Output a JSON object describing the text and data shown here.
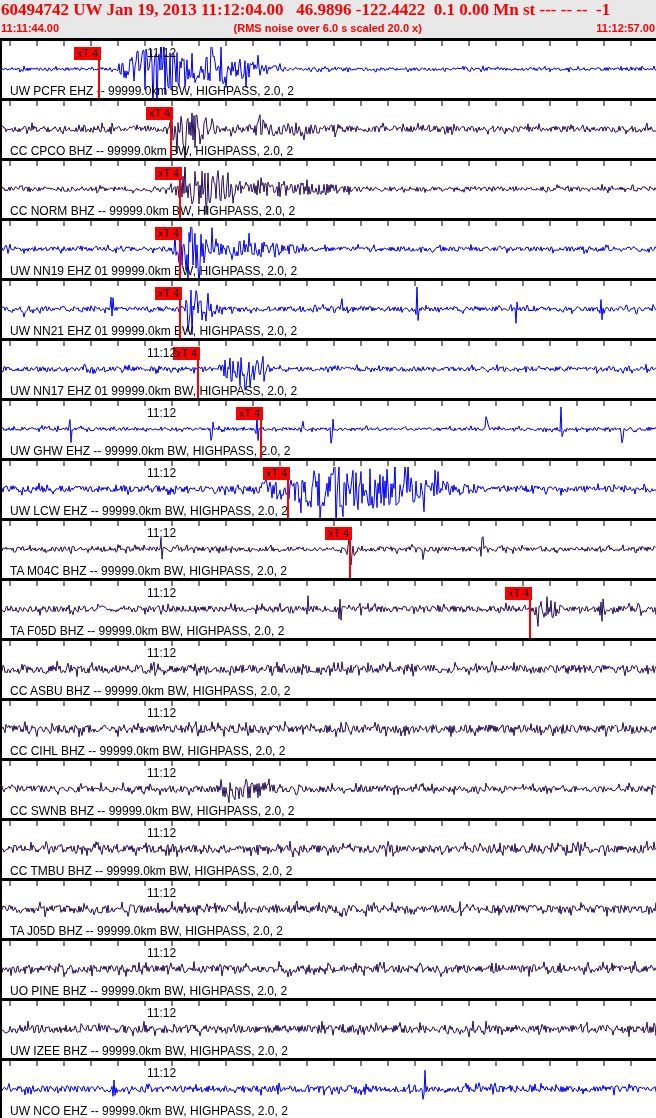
{
  "header": {
    "title": "60494742 UW Jan 19, 2013 11:12:04.00   46.9896 -122.4422  0.1 0.00 Mn st --- -- --  -1",
    "start_time": "11:11:44.00",
    "note": "(RMS noise over 6.0 s scaled 20.0 x)",
    "end_time": "11:12:57.00"
  },
  "traces": [
    {
      "label": "UW PCFR EHZ -- 99999.0km BW, HIGHPASS, 2.0, 2",
      "time_label": "11:12",
      "color": "#0000ff",
      "pick": "xT 4"
    },
    {
      "label": "CC CPCO BHZ -- 99999.0km BW, HIGHPASS, 2.0, 2",
      "color": "#2a0f5e",
      "pick": "xT 4"
    },
    {
      "label": "CC NORM BHZ -- 99999.0km BW, HIGHPASS, 2.0, 2",
      "color": "#2a0f5e",
      "pick": "xT 4"
    },
    {
      "label": "UW NN19 EHZ 01 99999.0km BW, HIGHPASS, 2.0, 2",
      "color": "#0000ff",
      "pick": "xT 4"
    },
    {
      "label": "UW NN21 EHZ 01 99999.0km BW, HIGHPASS, 2.0, 2",
      "color": "#0000ff",
      "pick": "xT 4"
    },
    {
      "label": "UW NN17 EHZ 01 99999.0km BW, HIGHPASS, 2.0, 2",
      "time_label": "11:12",
      "color": "#0000ff",
      "pick": "xT 4"
    },
    {
      "label": "UW GHW EHZ -- 99999.0km BW, HIGHPASS, 2.0, 2",
      "time_label": "11:12",
      "color": "#0000ff",
      "pick": "xT 4"
    },
    {
      "label": "UW LCW EHZ -- 99999.0km BW, HIGHPASS, 2.0, 2",
      "time_label": "11:12",
      "color": "#0000ff",
      "pick": "xT 4"
    },
    {
      "label": "TA M04C BHZ -- 99999.0km BW, HIGHPASS, 2.0, 2",
      "time_label": "11:12",
      "color": "#2a0f5e",
      "pick": "xT 4"
    },
    {
      "label": "TA F05D BHZ -- 99999.0km BW, HIGHPASS, 2.0, 2",
      "time_label": "11:12",
      "color": "#2a0f5e",
      "pick": "xT 4"
    },
    {
      "label": "CC ASBU BHZ -- 99999.0km BW, HIGHPASS, 2.0, 2",
      "time_label": "11:12",
      "color": "#2a0f5e"
    },
    {
      "label": "CC CIHL BHZ -- 99999.0km BW, HIGHPASS, 2.0, 2",
      "time_label": "11:12",
      "color": "#2a0f5e"
    },
    {
      "label": "CC SWNB BHZ -- 99999.0km BW, HIGHPASS, 2.0, 2",
      "time_label": "11:12",
      "color": "#2a0f5e"
    },
    {
      "label": "CC TMBU BHZ -- 99999.0km BW, HIGHPASS, 2.0, 2",
      "time_label": "11:12",
      "color": "#2a0f5e"
    },
    {
      "label": "TA J05D BHZ -- 99999.0km BW, HIGHPASS, 2.0, 2",
      "time_label": "11:12",
      "color": "#2a0f5e"
    },
    {
      "label": "UO PINE BHZ -- 99999.0km BW, HIGHPASS, 2.0, 2",
      "time_label": "11:12",
      "color": "#2a0f5e"
    },
    {
      "label": "UW IZEE BHZ -- 99999.0km BW, HIGHPASS, 2.0, 2",
      "time_label": "11:12",
      "color": "#2a0f5e"
    },
    {
      "label": "UW NCO EHZ -- 99999.0km BW, HIGHPASS, 2.0, 2",
      "time_label": "11:12",
      "color": "#0000ff"
    }
  ]
}
